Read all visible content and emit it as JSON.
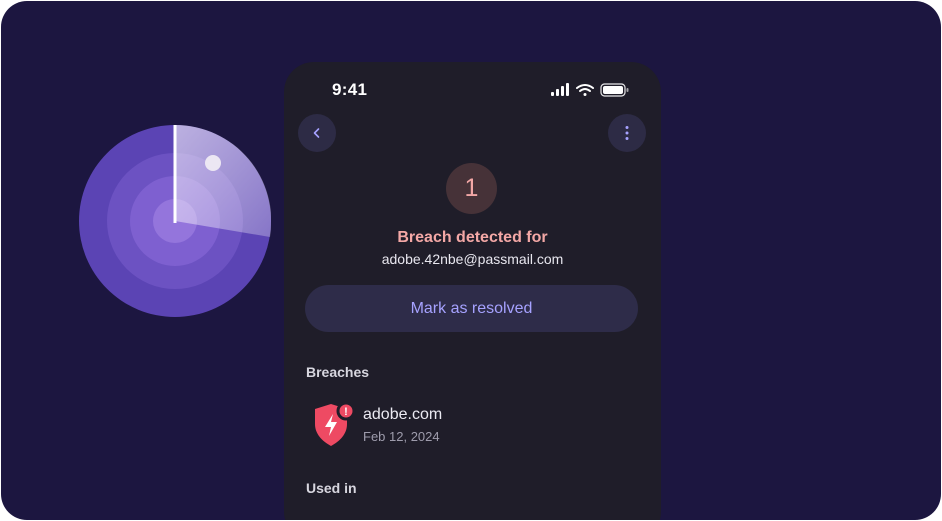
{
  "status_bar": {
    "time": "9:41",
    "icons": [
      "signal-icon",
      "wifi-icon",
      "battery-icon"
    ]
  },
  "nav": {
    "back_icon": "chevron-left-icon",
    "more_icon": "more-vertical-icon"
  },
  "breach_summary": {
    "count": "1",
    "title": "Breach detected for",
    "email": "adobe.42nbe@passmail.com"
  },
  "actions": {
    "resolve_label": "Mark as resolved"
  },
  "breaches": {
    "heading": "Breaches",
    "items": [
      {
        "domain": "adobe.com",
        "date": "Feb 12, 2024",
        "icon": "shield-alert-icon",
        "badge": "!"
      }
    ]
  },
  "used_in": {
    "heading": "Used in"
  },
  "colors": {
    "background": "#1c1640",
    "phone_surface": "#1f1d29",
    "alert_text": "#f4a8a6",
    "accent": "#a6a2ff",
    "shield": "#ee4a63"
  }
}
